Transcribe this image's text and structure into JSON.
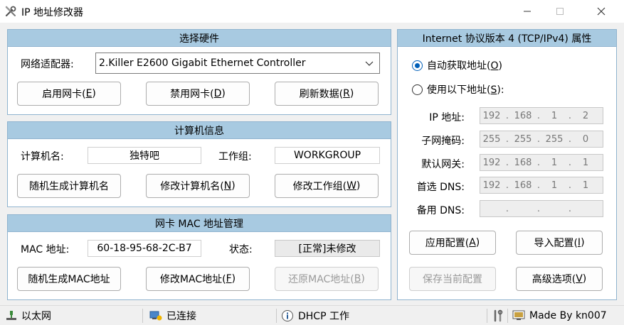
{
  "window": {
    "title": "IP 地址修改器"
  },
  "hardware": {
    "title": "选择硬件",
    "adapter_label": "网络适配器:",
    "adapter_value": "2.Killer E2600 Gigabit Ethernet Controller",
    "enable_pre": "启用网卡(",
    "enable_key": "E",
    "enable_post": ")",
    "disable_pre": "禁用网卡(",
    "disable_key": "D",
    "disable_post": ")",
    "refresh_pre": "刷新数据(",
    "refresh_key": "R",
    "refresh_post": ")"
  },
  "computer": {
    "title": "计算机信息",
    "name_label": "计算机名:",
    "name_value": "独特吧",
    "workgroup_label": "工作组:",
    "workgroup_value": "WORKGROUP",
    "random_btn": "随机生成计算机名",
    "rename_pre": "修改计算机名(",
    "rename_key": "N",
    "rename_post": ")",
    "wg_pre": "修改工作组(",
    "wg_key": "W",
    "wg_post": ")"
  },
  "mac": {
    "title": "网卡 MAC 地址管理",
    "mac_label": "MAC 地址:",
    "mac_value": "60-18-95-68-2C-B7",
    "state_label": "状态:",
    "state_value": "[正常]未修改",
    "random_btn": "随机生成MAC地址",
    "modify_pre": "修改MAC地址(",
    "modify_key": "F",
    "modify_post": ")",
    "restore_pre": "还原MAC地址(",
    "restore_key": "B",
    "restore_post": ")"
  },
  "ipv4": {
    "title": "Internet 协议版本 4 (TCP/IPv4) 属性",
    "auto_pre": "自动获取地址(",
    "auto_key": "O",
    "auto_post": ")",
    "manual_pre": "使用以下地址(",
    "manual_key": "S",
    "manual_post": "):",
    "ip_label": "IP 地址:",
    "ip": [
      "192",
      "168",
      "1",
      "2"
    ],
    "mask_label": "子网掩码:",
    "mask": [
      "255",
      "255",
      "255",
      "0"
    ],
    "gateway_label": "默认网关:",
    "gateway": [
      "192",
      "168",
      "1",
      "1"
    ],
    "dns1_label": "首选 DNS:",
    "dns1": [
      "192",
      "168",
      "1",
      "1"
    ],
    "dns2_label": "备用 DNS:",
    "dns2": [
      "",
      "",
      "",
      ""
    ],
    "apply_pre": "应用配置(",
    "apply_key": "A",
    "apply_post": ")",
    "import_pre": "导入配置(",
    "import_key": "I",
    "import_post": ")",
    "save_btn": "保存当前配置",
    "adv_pre": "高级选项(",
    "adv_key": "V",
    "adv_post": ")"
  },
  "statusbar": {
    "conn_type": "以太网",
    "conn_state": "已连接",
    "dhcp": "DHCP 工作",
    "made_by": "Made By kn007"
  }
}
